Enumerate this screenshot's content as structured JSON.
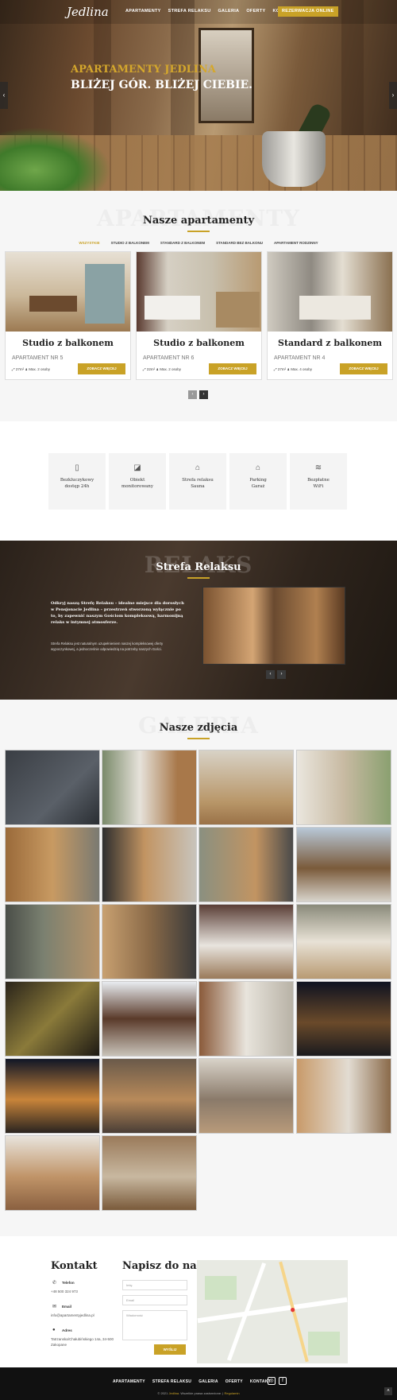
{
  "nav": {
    "logo": "Jedlina",
    "items": [
      "APARTAMENTY",
      "STREFA RELAKSU",
      "GALERIA",
      "OFERTY",
      "KONTAKT"
    ],
    "book": "REZERWACJA ONLINE"
  },
  "hero": {
    "line1": "APARTAMENTY JEDLINA",
    "line2": "BLIŻEJ GÓR. BLIŻEJ CIEBIE.",
    "prev": "‹",
    "next": "›"
  },
  "apartments": {
    "ghost": "APARTAMENTY",
    "title": "Nasze apartamenty",
    "filters": [
      "WSZYSTKIE",
      "STUDIO Z BALKONEM",
      "STANDARD Z BALKONEM",
      "STANDARD BEZ BALKONU",
      "APARTAMENT RODZINNY"
    ],
    "cards": [
      {
        "title": "Studio z balkonem",
        "no": "APARTAMENT NR 5",
        "area": "27m²",
        "max": "Max. 2 osoby",
        "more": "ZOBACZ WIĘCEJ"
      },
      {
        "title": "Studio z balkonem",
        "no": "APARTAMENT NR 6",
        "area": "22m²",
        "max": "Max. 2 osoby",
        "more": "ZOBACZ WIĘCEJ"
      },
      {
        "title": "Standard z balkonem",
        "no": "APARTAMENT NR 4",
        "area": "27m²",
        "max": "Max. 4 osoby",
        "more": "ZOBACZ WIĘCEJ"
      }
    ],
    "prev": "‹",
    "next": "›"
  },
  "features": [
    {
      "icon": "keycard-icon",
      "line1": "Bezkluczykowy",
      "line2": "dostęp 24h"
    },
    {
      "icon": "camera-icon",
      "line1": "Obiekt",
      "line2": "monitorowany"
    },
    {
      "icon": "sauna-icon",
      "line1": "Strefa relaksu",
      "line2": "Sauna"
    },
    {
      "icon": "garage-icon",
      "line1": "Parking",
      "line2": "Garaż"
    },
    {
      "icon": "wifi-icon",
      "line1": "Bezpłatne",
      "line2": "WiFi"
    }
  ],
  "relax": {
    "ghost": "RELAKS",
    "title": "Strefa Relaksu",
    "intro": "Odkryj naszą Strefę Relaksu – idealne miejsce dla dorosłych w Pensjonacie Jedlina – przestrzeń stworzoną wyłącznie po to, by zapewnić naszym Gościom kompleksową, harmonijną relaks w intymnej atmosferze.",
    "desc": "Strefa Relaksu jest naturalnym uzupełnieniem naszej kompleksowej oferty wypoczynkowej, a jednocześnie odpowiedzią na potrzeby naszych Gości.",
    "prev": "‹",
    "next": "›"
  },
  "gallery": {
    "ghost": "GALERIA",
    "title": "Nasze zdjęcia"
  },
  "contact": {
    "title": "Kontakt",
    "phone_label": "Telefon",
    "phone": "+48 500 324 973",
    "email_label": "Email",
    "email": "info@apartamentyjedlina.pl",
    "address_label": "Adres",
    "address1": "Tatrzanska/Chałubińskiego 14a, 34-500",
    "address2": "Zakopane",
    "form_title": "Napisz do nas",
    "name_ph": "Imię",
    "email_ph": "Email",
    "msg_ph": "Wiadomość",
    "send": "WYŚLIJ"
  },
  "footer": {
    "menu": [
      "APARTAMENTY",
      "STREFA RELAKSU",
      "GALERIA",
      "OFERTY",
      "KONTAKT"
    ],
    "copy_pre": "© 2021",
    "brand": "Jedlina",
    "copy_mid": ". Wszelkie prawa zastrzeżone. |",
    "regulamin": "Regulamin"
  },
  "colors": {
    "accent": "#c9a227",
    "footer": "#111111"
  }
}
